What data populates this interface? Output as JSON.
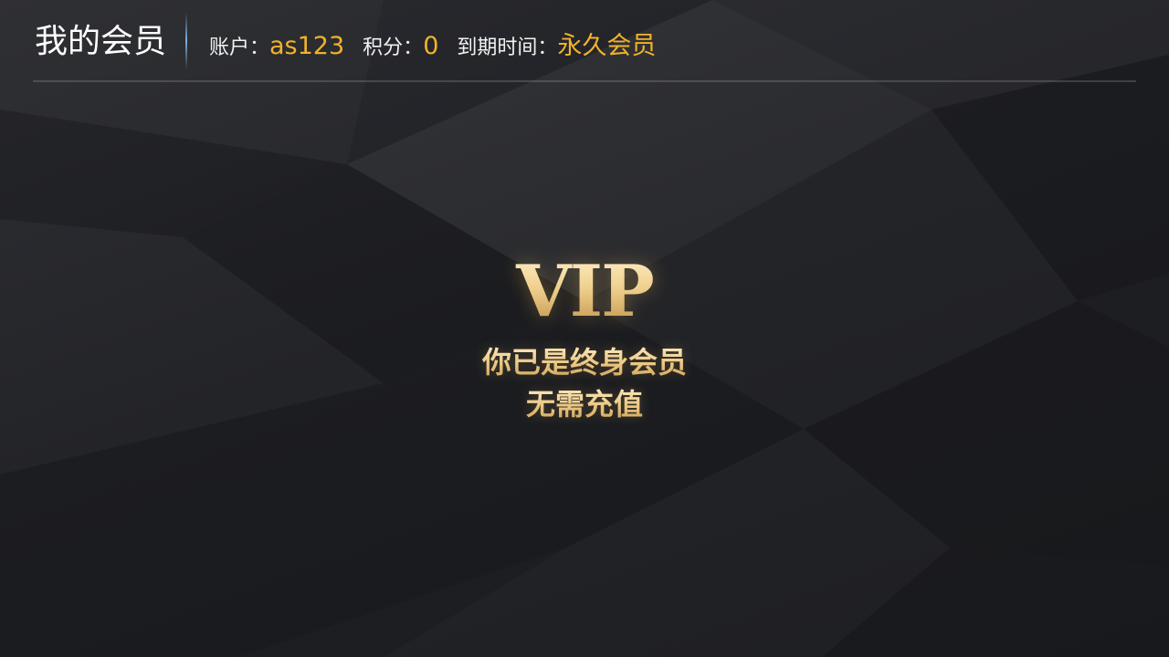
{
  "header": {
    "title": "我的会员",
    "account_label": "账户：",
    "account_value": "as123",
    "points_label": "积分：",
    "points_value": "0",
    "expiry_label": "到期时间：",
    "expiry_value": "永久会员"
  },
  "vip": {
    "logo_text": "VIP",
    "status_line_1": "你已是终身会员",
    "status_line_2": "无需充值"
  },
  "colors": {
    "background": "#1f2024",
    "accent_gold": "#f1b22c",
    "vip_gold": "#e7c583",
    "title_text": "#ffffff"
  }
}
